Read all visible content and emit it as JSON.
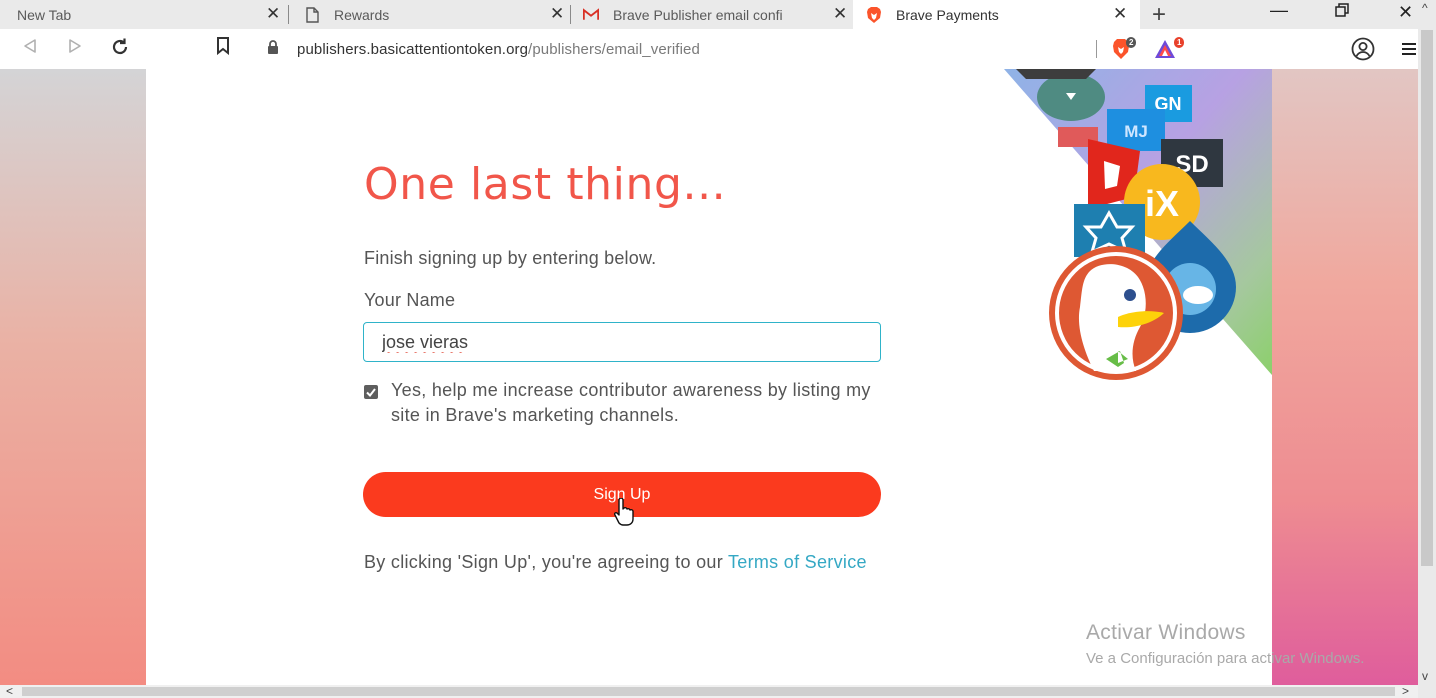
{
  "tabs": [
    {
      "title": "New Tab",
      "icon": "none"
    },
    {
      "title": "Rewards",
      "icon": "page-icon"
    },
    {
      "title": "Brave Publisher email confi",
      "icon": "gmail-icon"
    },
    {
      "title": "Brave Payments",
      "icon": "brave-lion-icon",
      "active": true
    }
  ],
  "toolbar": {
    "url_host": "publishers.basicattentiontoken.org",
    "url_path": "/publishers/email_verified",
    "shields_badge": "2",
    "rewards_badge": "1"
  },
  "page": {
    "heading": "One last thing...",
    "subtitle": "Finish signing up by entering below.",
    "name_label": "Your Name",
    "name_value": "jose vieras",
    "marketing_opt_in": true,
    "marketing_label": "Yes, help me increase contributor awareness by listing my site in Brave's marketing channels.",
    "signup_label": "Sign Up",
    "terms_prefix": "By clicking 'Sign Up', you're agreeing to our ",
    "terms_link": "Terms of Service",
    "decor_labels": {
      "gn": "GN",
      "sd": "SD",
      "ix": "iX"
    }
  },
  "watermark": {
    "title": "Activar Windows",
    "subtitle": "Ve a Configuración para activar Windows."
  },
  "colors": {
    "accent": "#f1564a",
    "button": "#fb3a1e",
    "input_border": "#2fb3c9",
    "link": "#34a8c4"
  }
}
